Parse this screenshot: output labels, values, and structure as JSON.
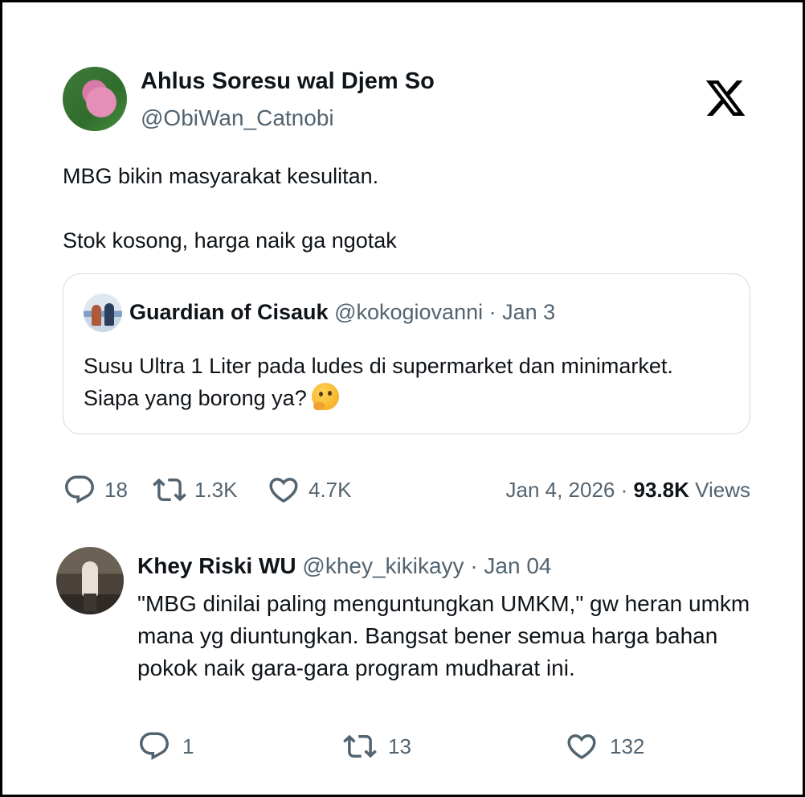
{
  "tweet": {
    "author_name": "Ahlus Soresu wal Djem So",
    "author_handle": "@ObiWan_Catnobi",
    "text_line1": "MBG bikin masyarakat kesulitan.",
    "text_line2": "Stok kosong, harga naik ga ngotak",
    "quote": {
      "name": "Guardian of Cisauk",
      "meta": "@kokogiovanni · Jan 3",
      "text": "Susu Ultra 1 Liter pada ludes di supermarket dan minimarket. Siapa yang borong ya?"
    },
    "stats": {
      "replies": "18",
      "reposts": "1.3K",
      "likes": "4.7K",
      "date": "Jan 4, 2026 · ",
      "views_count": "93.8K",
      "views_label": " Views"
    }
  },
  "reply": {
    "name": "Khey Riski WU",
    "meta": "@khey_kikikayy · Jan 04",
    "text": "\"MBG dinilai paling menguntungkan UMKM,\" gw heran umkm mana yg diuntungkan. Bangsat bener semua harga bahan pokok naik gara-gara program mudharat ini.",
    "replies": "1",
    "reposts": "13",
    "likes": "132"
  },
  "icons": {
    "brand": "x-logo-icon",
    "reply": "reply-bubble-icon",
    "repost": "repost-icon",
    "like": "heart-icon"
  },
  "colors": {
    "text_primary": "#0f1419",
    "text_secondary": "#536471",
    "border": "#cfd9de"
  }
}
